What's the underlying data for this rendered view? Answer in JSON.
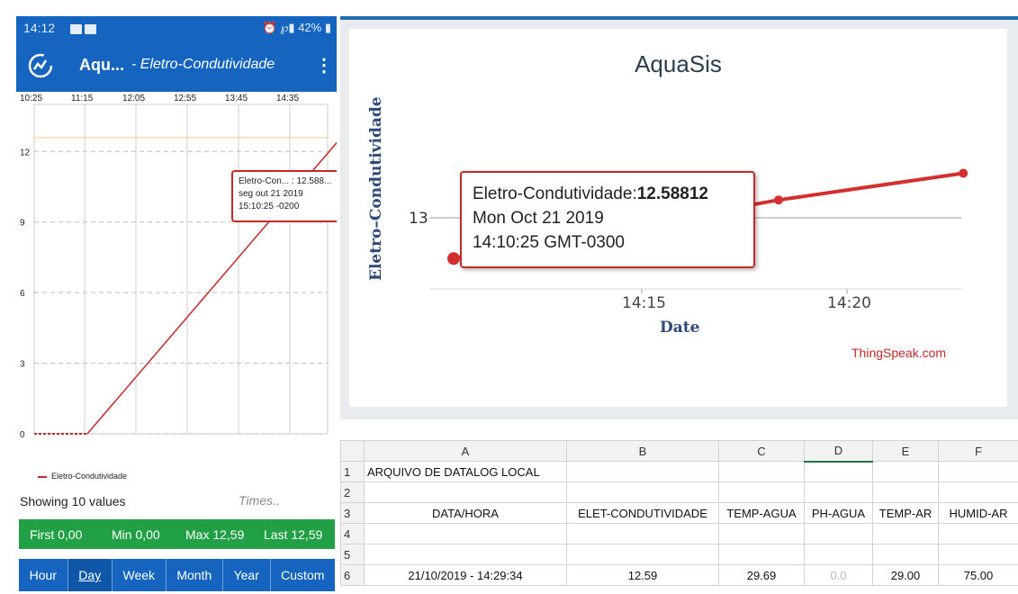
{
  "phone": {
    "status": {
      "time": "14:12",
      "battery": "42%"
    },
    "appbar": {
      "title": "Aqu...",
      "subtitle": "- Eletro-Condutividade",
      "menu": "⋮"
    },
    "chart": {
      "x_ticks": [
        "10:25",
        "11:15",
        "12:05",
        "12:55",
        "13:45",
        "14:35"
      ],
      "y_ticks": [
        "0",
        "3",
        "6",
        "9",
        "12"
      ],
      "tooltip": {
        "line1": "Eletro-Con... : 12.588...",
        "line2": "seg out 21 2019",
        "line3": "15:10:25 -0200"
      }
    },
    "legend": "Eletro-Condutividade",
    "showing": "Showing  10 values",
    "timescale": "Times..",
    "stats": {
      "first": "First 0,00",
      "min": "Min 0,00",
      "max": "Max 12,59",
      "last": "Last 12,59"
    },
    "ranges": [
      "Hour",
      "Day",
      "Week",
      "Month",
      "Year",
      "Custom"
    ],
    "active_range": "Day"
  },
  "thingspeak": {
    "title": "AquaSis",
    "ylabel": "Eletro–Condutividade",
    "xlabel": "Date",
    "credit": "ThingSpeak.com",
    "tooltip": {
      "label": "Eletro-Condutividade:",
      "value": "12.58812",
      "date": "Mon Oct 21 2019",
      "time": "14:10:25 GMT-0300"
    }
  },
  "chart_data": [
    {
      "type": "line",
      "title": "",
      "xlabel": "",
      "ylabel": "",
      "x": [
        "10:25",
        "11:15",
        "12:05",
        "12:55",
        "13:45",
        "14:35"
      ],
      "x_ticks": [
        "10:25",
        "11:15",
        "12:05",
        "12:55",
        "13:45",
        "14:35"
      ],
      "y_ticks": [
        0,
        3,
        6,
        9,
        12
      ],
      "ylim": [
        0,
        14
      ],
      "grid": true,
      "series": [
        {
          "name": "Eletro-Condutividade",
          "color": "#c62828",
          "values": [
            0,
            0,
            3.2,
            6.6,
            10.0,
            12.59
          ]
        }
      ]
    },
    {
      "type": "line",
      "title": "AquaSis",
      "xlabel": "Date",
      "ylabel": "Eletro–Condutividade",
      "x_ticks": [
        "14:15",
        "14:20"
      ],
      "y_ticks": [
        13
      ],
      "grid": true,
      "series": [
        {
          "color": "#c62828",
          "points": [
            {
              "x": "14:10:25",
              "y": 12.58812
            },
            {
              "x": "14:18:20",
              "y": 13.18
            },
            {
              "x": "14:22:50",
              "y": 13.45
            }
          ]
        }
      ]
    }
  ],
  "sheet": {
    "columns": [
      "A",
      "B",
      "C",
      "D",
      "E",
      "F"
    ],
    "selected_column": "D",
    "rows": [
      {
        "n": "1",
        "cells": [
          "ARQUIVO DE DATALOG LOCAL",
          "",
          "",
          "",
          "",
          ""
        ]
      },
      {
        "n": "2",
        "cells": [
          "",
          "",
          "",
          "",
          "",
          ""
        ]
      },
      {
        "n": "3",
        "cells": [
          "DATA/HORA",
          "ELET-CONDUTIVIDADE",
          "TEMP-AGUA",
          "PH-AGUA",
          "TEMP-AR",
          "HUMID-AR"
        ]
      },
      {
        "n": "4",
        "cells": [
          "",
          "",
          "",
          "",
          "",
          ""
        ]
      },
      {
        "n": "5",
        "cells": [
          "",
          "",
          "",
          "",
          "",
          ""
        ]
      },
      {
        "n": "6",
        "cells": [
          "21/10/2019 - 14:29:34",
          "12.59",
          "29.69",
          "0.0",
          "29.00",
          "75.00"
        ]
      }
    ]
  }
}
